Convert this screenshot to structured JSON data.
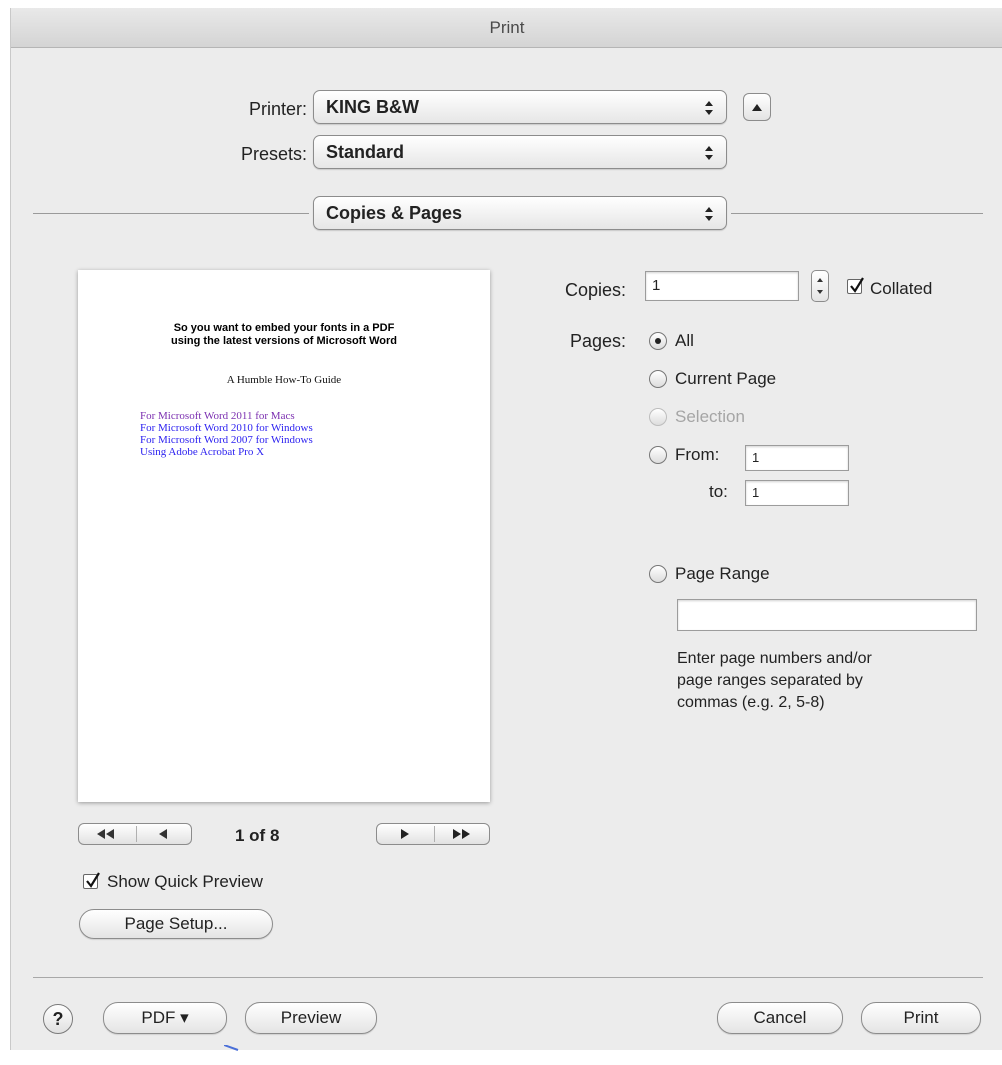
{
  "window": {
    "title": "Print"
  },
  "printer": {
    "label": "Printer:",
    "value": "KING B&W"
  },
  "presets": {
    "label": "Presets:",
    "value": "Standard"
  },
  "panel": {
    "value": "Copies & Pages"
  },
  "preview": {
    "doc_title_line1": "So you want to embed your fonts in a PDF",
    "doc_title_line2": "using the latest versions of Microsoft Word",
    "doc_subtitle": "A Humble How-To Guide",
    "doc_links": [
      "For Microsoft Word 2011 for Macs",
      "For Microsoft Word 2010 for Windows",
      "For Microsoft Word 2007 for Windows",
      "Using Adobe Acrobat Pro X"
    ],
    "page_indicator": "1 of 8",
    "show_quick_preview_label": "Show Quick Preview",
    "show_quick_preview_checked": true,
    "page_setup_label": "Page Setup..."
  },
  "copies": {
    "label": "Copies:",
    "value": "1",
    "collated_label": "Collated",
    "collated_checked": true
  },
  "pages": {
    "label": "Pages:",
    "selected": "All",
    "all_label": "All",
    "current_label": "Current Page",
    "selection_label": "Selection",
    "from_label": "From:",
    "from_value": "1",
    "to_label": "to:",
    "to_value": "1",
    "range_label": "Page Range",
    "range_value": "",
    "hint_line1": "Enter page numbers and/or",
    "hint_line2": "page ranges separated by",
    "hint_line3": "commas (e.g. 2, 5-8)"
  },
  "footer": {
    "help_label": "?",
    "pdf_label": "PDF ▾",
    "preview_label": "Preview",
    "cancel_label": "Cancel",
    "print_label": "Print"
  }
}
